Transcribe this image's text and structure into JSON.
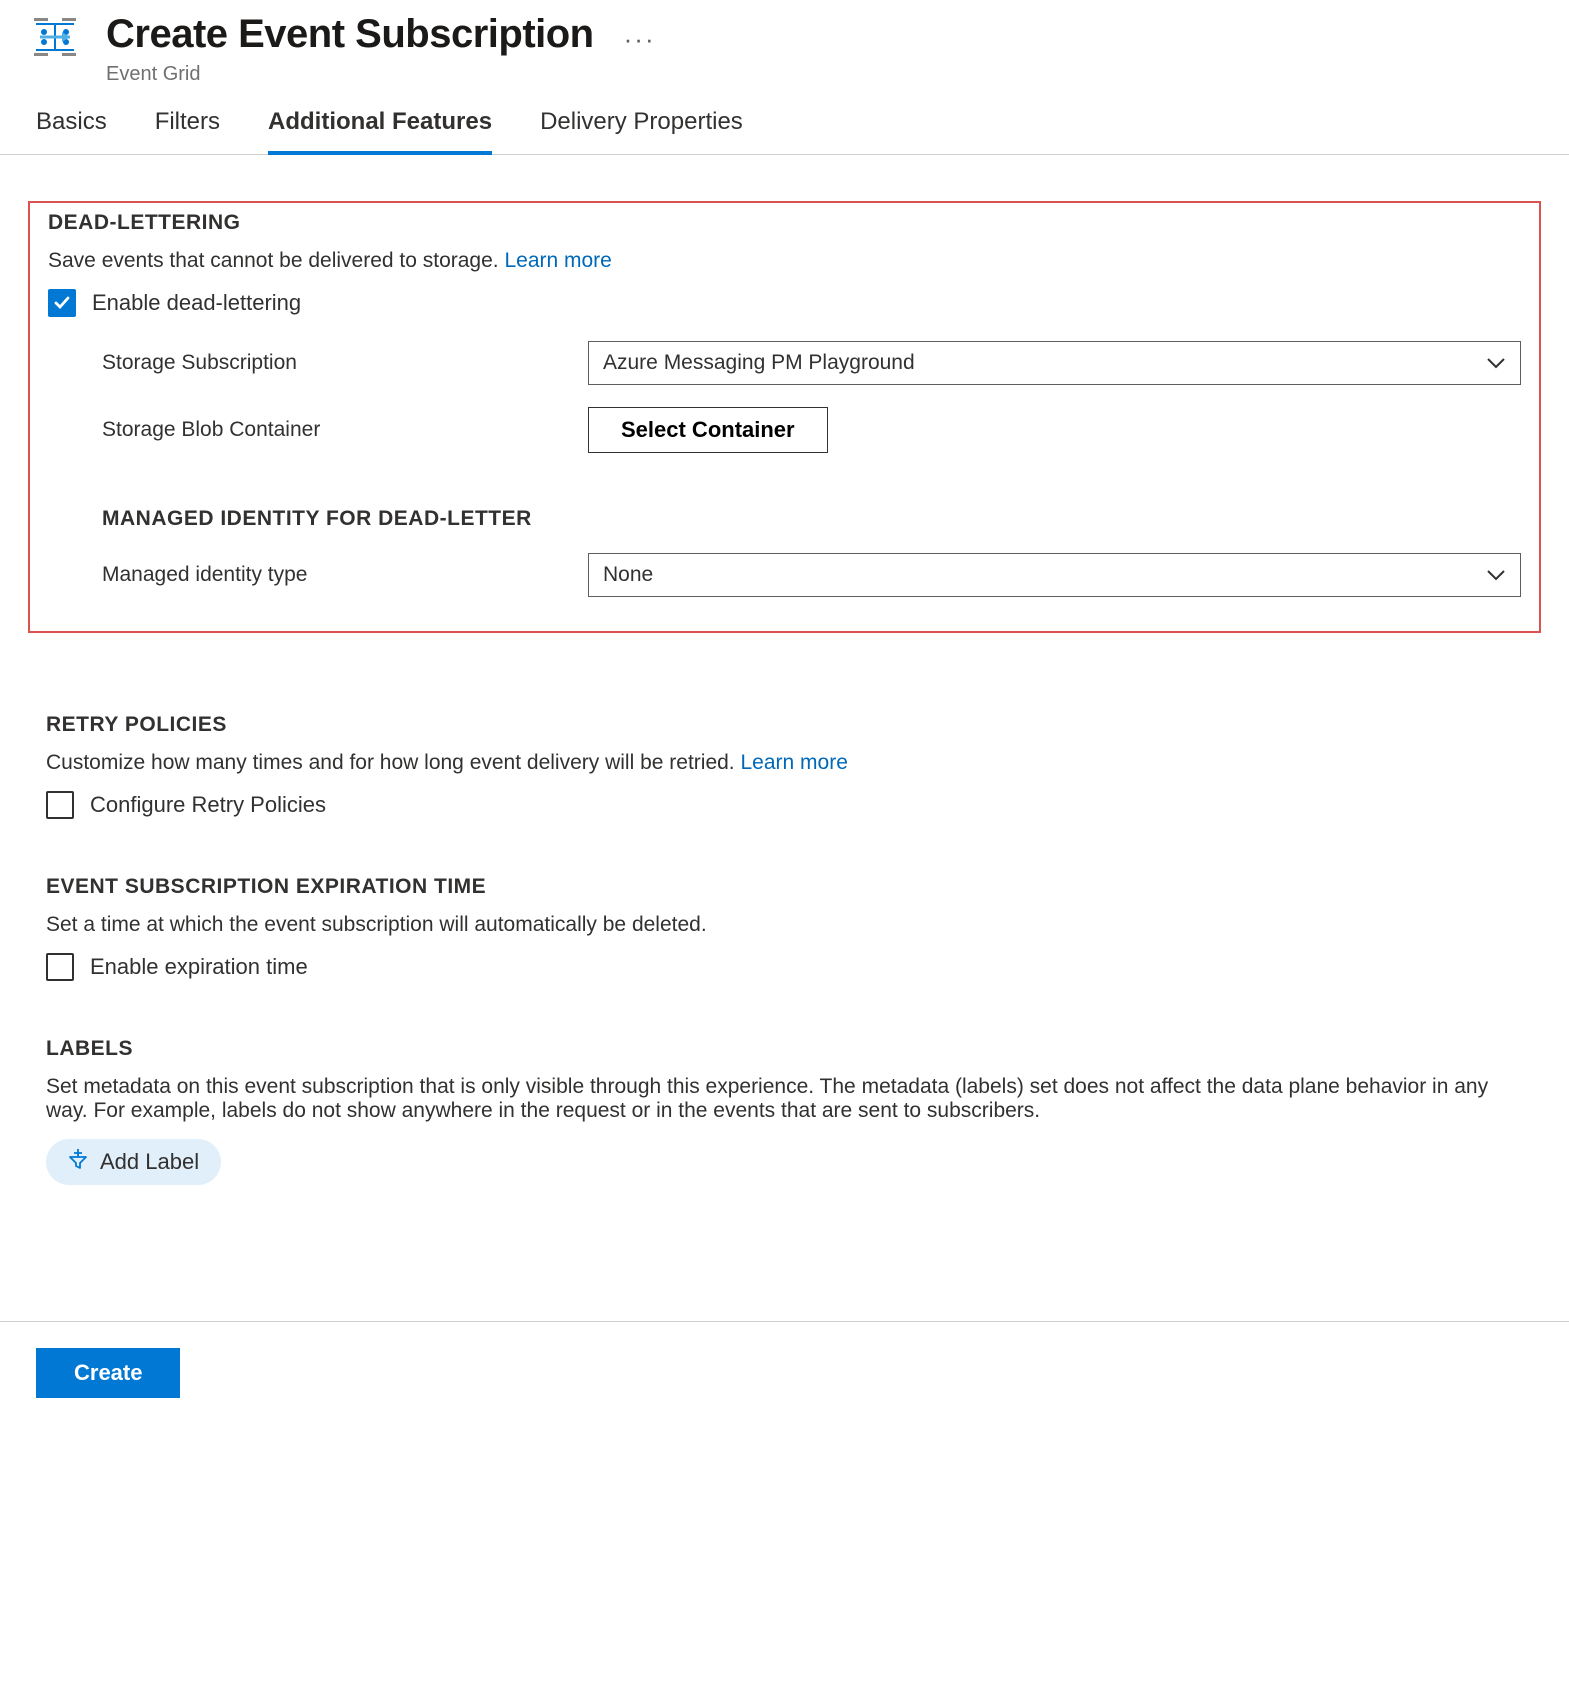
{
  "header": {
    "title": "Create Event Subscription",
    "subtitle": "Event Grid"
  },
  "tabs": {
    "basics": "Basics",
    "filters": "Filters",
    "additional": "Additional Features",
    "delivery": "Delivery Properties"
  },
  "deadletter": {
    "title": "DEAD-LETTERING",
    "desc": "Save events that cannot be delivered to storage. ",
    "learn": "Learn more",
    "enable_label": "Enable dead-lettering",
    "storage_sub_label": "Storage Subscription",
    "storage_sub_value": "Azure Messaging PM Playground",
    "blob_label": "Storage Blob Container",
    "select_container": "Select Container",
    "mi_title": "MANAGED IDENTITY FOR DEAD-LETTER",
    "mi_type_label": "Managed identity type",
    "mi_type_value": "None"
  },
  "retry": {
    "title": "RETRY POLICIES",
    "desc": "Customize how many times and for how long event delivery will be retried. ",
    "learn": "Learn more",
    "configure_label": "Configure Retry Policies"
  },
  "expiration": {
    "title": "EVENT SUBSCRIPTION EXPIRATION TIME",
    "desc": "Set a time at which the event subscription will automatically be deleted.",
    "enable_label": "Enable expiration time"
  },
  "labels": {
    "title": "LABELS",
    "desc": "Set metadata on this event subscription that is only visible through this experience. The metadata (labels) set does not affect the data plane behavior in any way. For example, labels do not show anywhere in the request or in the events that are sent to subscribers.",
    "add_label": "Add Label"
  },
  "footer": {
    "create": "Create"
  }
}
